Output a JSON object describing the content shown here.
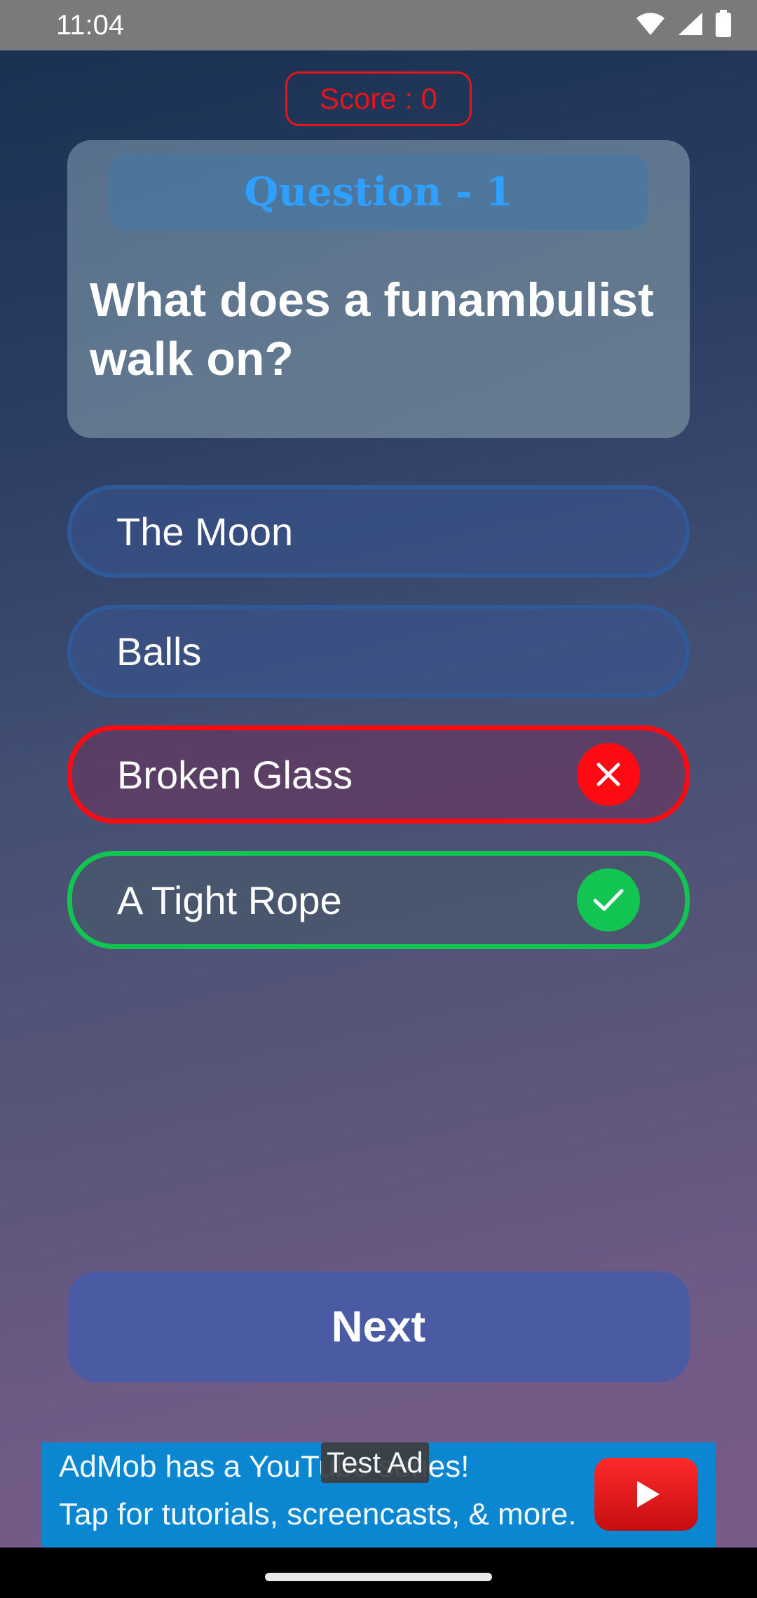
{
  "status_bar": {
    "time": "11:04",
    "icons": [
      "wifi-icon",
      "signal-icon",
      "battery-icon"
    ]
  },
  "score": {
    "label": "Score : 0"
  },
  "question": {
    "header": "Question - 1",
    "text": "What does a funambulist walk on?"
  },
  "options": [
    {
      "label": "The Moon",
      "state": "default"
    },
    {
      "label": "Balls",
      "state": "default"
    },
    {
      "label": "Broken Glass",
      "state": "wrong",
      "icon": "close-icon"
    },
    {
      "label": "A Tight Rope",
      "state": "correct",
      "icon": "check-icon"
    }
  ],
  "next_button": {
    "label": "Next"
  },
  "ad": {
    "badge": "Test Ad",
    "line1": "AdMob has a YouTube series!",
    "line2": "Tap for tutorials, screencasts, & more.",
    "icon": "youtube-play-icon"
  },
  "colors": {
    "wrong": "#ff0a12",
    "correct": "#12c452",
    "score": "#e8141c",
    "question_header": "#2fa0ff",
    "next_button": "#4a5aa3",
    "ad_background": "#0a87d0"
  }
}
